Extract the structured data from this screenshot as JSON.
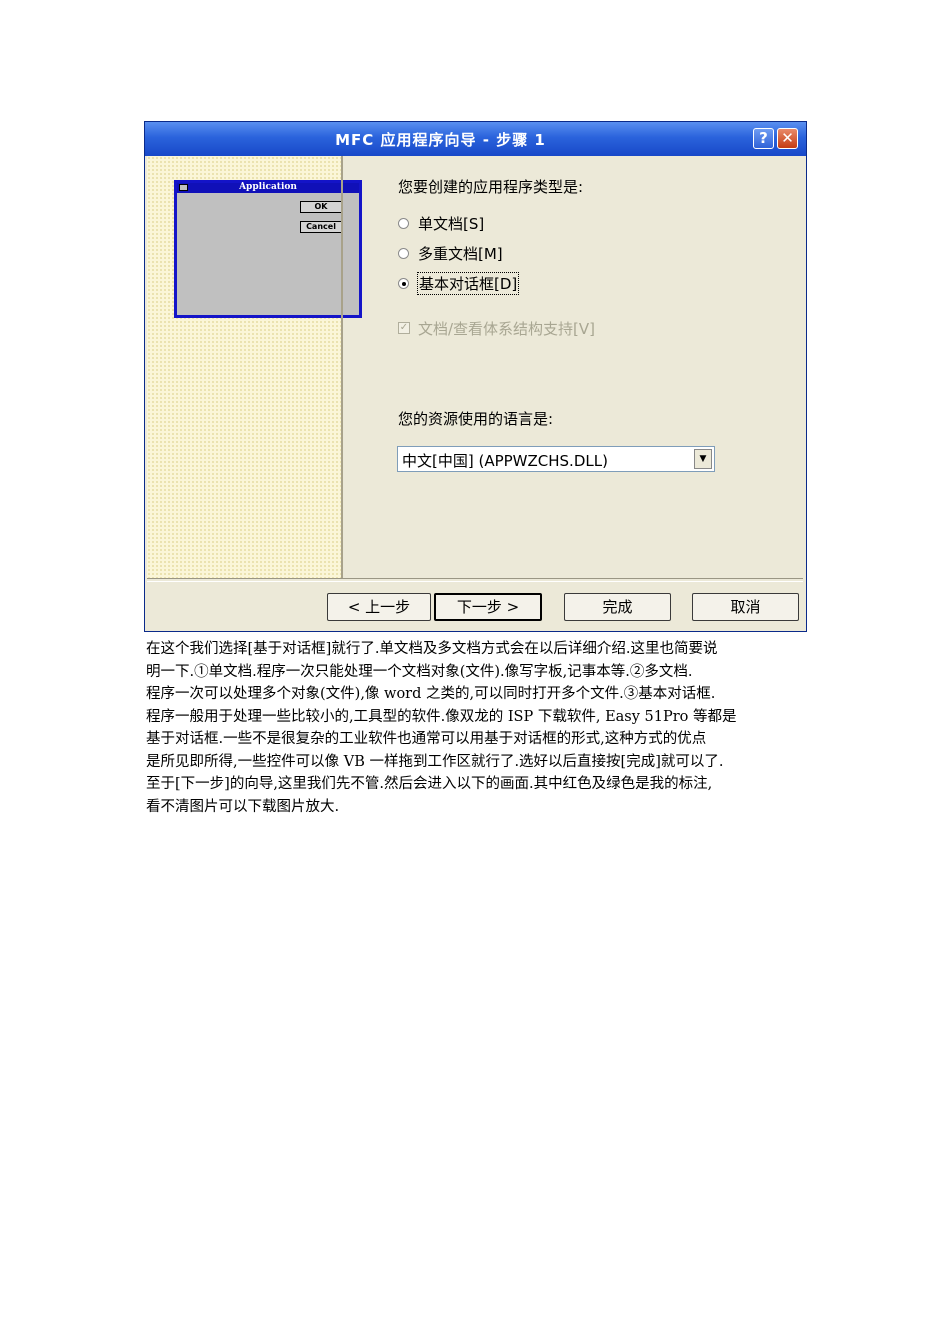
{
  "window": {
    "title": "MFC 应用程序向导 - 步骤 1",
    "help_glyph": "?",
    "close_glyph": "✕"
  },
  "preview": {
    "title": "Application",
    "ok": "OK",
    "cancel": "Cancel"
  },
  "form": {
    "type_question": "您要创建的应用程序类型是:",
    "options": [
      {
        "label": "单文档[S]",
        "selected": false
      },
      {
        "label": "多重文档[M]",
        "selected": false
      },
      {
        "label": "基本对话框[D]",
        "selected": true
      }
    ],
    "docview_label": "文档/查看体系结构支持[V]",
    "docview_check": "✓",
    "lang_question": "您的资源使用的语言是:",
    "lang_value": "中文[中国] (APPWZCHS.DLL)",
    "lang_arrow": "▼"
  },
  "buttons": {
    "back": "< 上一步",
    "next": "下一步 >",
    "finish": "完成",
    "cancel": "取消"
  },
  "paragraph_lines": [
    "在这个我们选择[基于对话框]就行了.单文档及多文档方式会在以后详细介绍.这里也简要说",
    "明一下.①单文档.程序一次只能处理一个文档对象(文件).像写字板,记事本等.②多文档.",
    "程序一次可以处理多个对象(文件),像 word 之类的,可以同时打开多个文件.③基本对话框.",
    "程序一般用于处理一些比较小的,工具型的软件.像双龙的 ISP 下载软件, Easy 51Pro 等都是",
    "基于对话框.一些不是很复杂的工业软件也通常可以用基于对话框的形式,这种方式的优点",
    "是所见即所得,一些控件可以像 VB 一样拖到工作区就行了.选好以后直接按[完成]就可以了.",
    "至于[下一步]的向导,这里我们先不管.然后会进入以下的画面.其中红色及绿色是我的标注,",
    "看不清图片可以下载图片放大."
  ]
}
